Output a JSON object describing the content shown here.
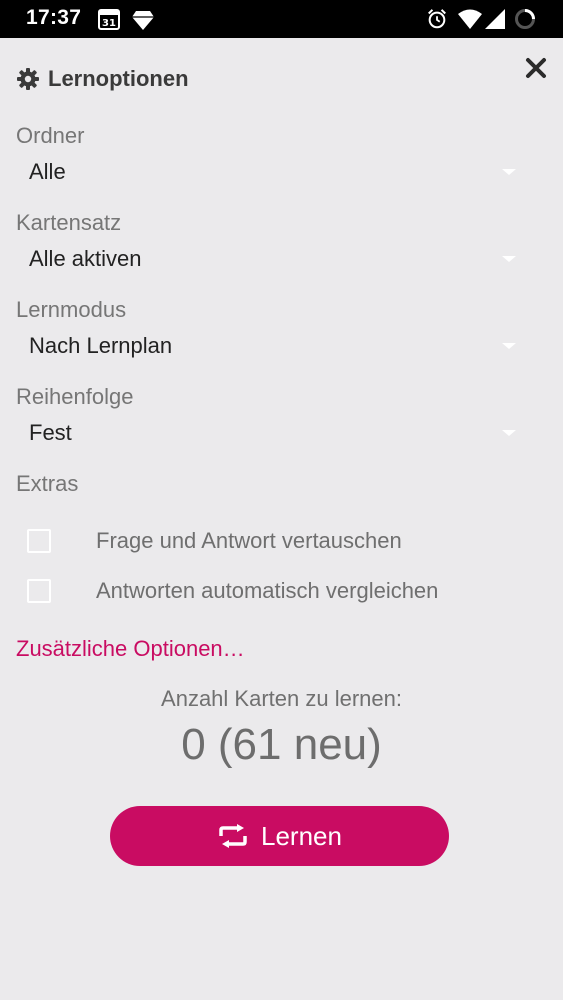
{
  "status_bar": {
    "time": "17:37",
    "calendar_day": "31"
  },
  "dialog": {
    "title": "Lernoptionen",
    "fields": [
      {
        "label": "Ordner",
        "value": "Alle"
      },
      {
        "label": "Kartensatz",
        "value": "Alle aktiven"
      },
      {
        "label": "Lernmodus",
        "value": "Nach Lernplan"
      },
      {
        "label": "Reihenfolge",
        "value": "Fest"
      }
    ],
    "extras_label": "Extras",
    "checkboxes": [
      {
        "label": "Frage und Antwort vertauschen",
        "checked": false
      },
      {
        "label": "Antworten automatisch vergleichen",
        "checked": false
      }
    ],
    "more_options": "Zusätzliche Optionen…",
    "count_label": "Anzahl Karten zu lernen:",
    "count_value": "0 (61 neu)",
    "learn_button": "Lernen"
  },
  "colors": {
    "accent": "#c90c62",
    "background": "#ebeaec"
  }
}
